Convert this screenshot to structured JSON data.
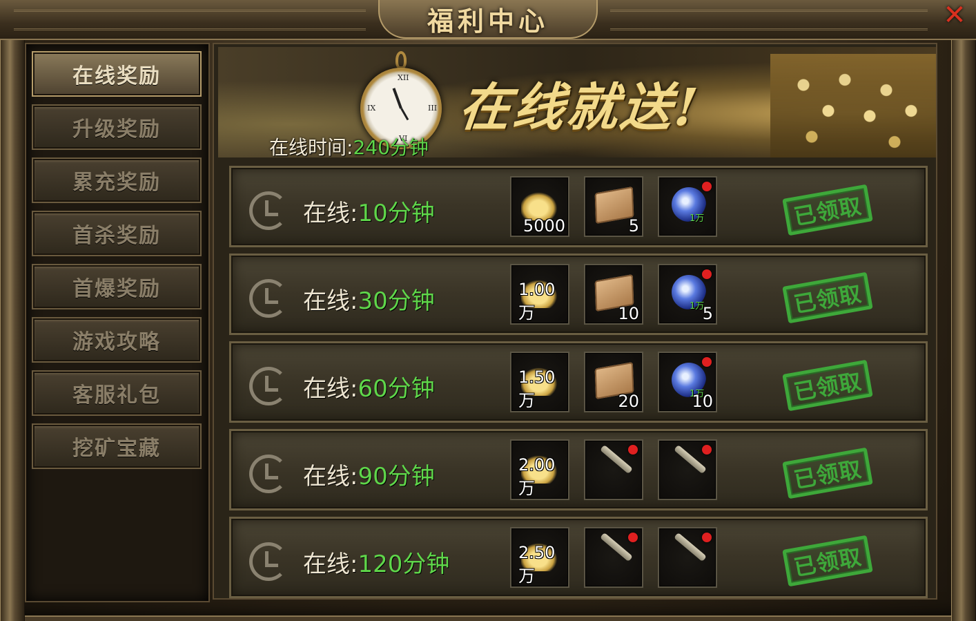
{
  "window": {
    "title": "福利中心",
    "close_label": "✕"
  },
  "sidebar": {
    "items": [
      {
        "label": "在线奖励",
        "active": true
      },
      {
        "label": "升级奖励",
        "active": false
      },
      {
        "label": "累充奖励",
        "active": false
      },
      {
        "label": "首杀奖励",
        "active": false
      },
      {
        "label": "首爆奖励",
        "active": false
      },
      {
        "label": "游戏攻略",
        "active": false
      },
      {
        "label": "客服礼包",
        "active": false
      },
      {
        "label": "挖矿宝藏",
        "active": false
      }
    ]
  },
  "banner": {
    "slogan": "在线就送!",
    "online_time_label": "在线时间:",
    "online_time_value": "240分钟"
  },
  "rows": [
    {
      "label": "在线:",
      "time": "10分钟",
      "status": "已领取",
      "items": [
        {
          "icon": "gold-icon",
          "qty": "5000",
          "dot": false
        },
        {
          "icon": "scroll-icon",
          "qty": "5",
          "dot": false
        },
        {
          "icon": "orb-icon",
          "qty": "",
          "tag": "1万",
          "dot": true
        }
      ]
    },
    {
      "label": "在线:",
      "time": "30分钟",
      "status": "已领取",
      "items": [
        {
          "icon": "gold-icon",
          "qty": "1.00万",
          "dot": false
        },
        {
          "icon": "scroll-icon",
          "qty": "10",
          "dot": false
        },
        {
          "icon": "orb-icon",
          "qty": "5",
          "tag": "1万",
          "dot": true
        }
      ]
    },
    {
      "label": "在线:",
      "time": "60分钟",
      "status": "已领取",
      "items": [
        {
          "icon": "gold-icon",
          "qty": "1.50万",
          "dot": false
        },
        {
          "icon": "scroll-icon",
          "qty": "20",
          "dot": false
        },
        {
          "icon": "orb-icon",
          "qty": "10",
          "tag": "1万",
          "dot": true
        }
      ]
    },
    {
      "label": "在线:",
      "time": "90分钟",
      "status": "已领取",
      "items": [
        {
          "icon": "gold-icon",
          "qty": "2.00万",
          "dot": false
        },
        {
          "icon": "stick-icon",
          "qty": "",
          "dot": true
        },
        {
          "icon": "stick-icon",
          "qty": "",
          "dot": true
        }
      ]
    },
    {
      "label": "在线:",
      "time": "120分钟",
      "status": "已领取",
      "items": [
        {
          "icon": "gold-icon",
          "qty": "2.50万",
          "dot": false
        },
        {
          "icon": "stick-icon",
          "qty": "",
          "dot": true
        },
        {
          "icon": "stick-icon",
          "qty": "",
          "dot": true
        }
      ]
    }
  ],
  "colors": {
    "highlight_green": "#5fd64a",
    "stamp_green": "#3ea83a",
    "close_red": "#d8301f"
  }
}
